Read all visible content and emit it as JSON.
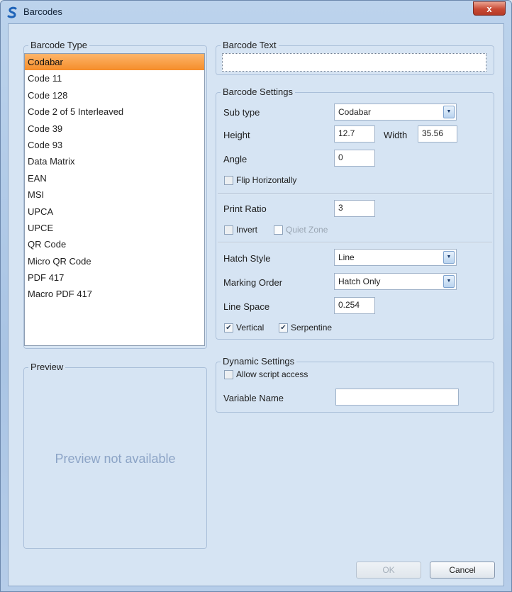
{
  "window": {
    "title": "Barcodes",
    "close_label": "x"
  },
  "barcode_type": {
    "legend": "Barcode Type",
    "items": [
      "Codabar",
      "Code 11",
      "Code 128",
      "Code 2 of 5 Interleaved",
      "Code 39",
      "Code 93",
      "Data Matrix",
      "EAN",
      "MSI",
      "UPCA",
      "UPCE",
      "QR Code",
      "Micro QR Code",
      "PDF 417",
      "Macro PDF 417"
    ],
    "selected": "Codabar"
  },
  "preview": {
    "legend": "Preview",
    "message": "Preview not available"
  },
  "barcode_text": {
    "legend": "Barcode Text",
    "value": ""
  },
  "barcode_settings": {
    "legend": "Barcode Settings",
    "sub_type_label": "Sub type",
    "sub_type_value": "Codabar",
    "height_label": "Height",
    "height_value": "12.7",
    "width_label": "Width",
    "width_value": "35.56",
    "angle_label": "Angle",
    "angle_value": "0",
    "flip_label": "Flip Horizontally",
    "flip_checked": false,
    "print_ratio_label": "Print Ratio",
    "print_ratio_value": "3",
    "invert_label": "Invert",
    "invert_checked": false,
    "quiet_zone_label": "Quiet Zone",
    "quiet_zone_checked": false,
    "hatch_style_label": "Hatch Style",
    "hatch_style_value": "Line",
    "marking_order_label": "Marking Order",
    "marking_order_value": "Hatch Only",
    "line_space_label": "Line Space",
    "line_space_value": "0.254",
    "vertical_label": "Vertical",
    "vertical_checked": true,
    "serpentine_label": "Serpentine",
    "serpentine_checked": true
  },
  "dynamic_settings": {
    "legend": "Dynamic Settings",
    "allow_script_label": "Allow script access",
    "allow_script_checked": false,
    "variable_name_label": "Variable Name",
    "variable_name_value": ""
  },
  "buttons": {
    "ok": "OK",
    "cancel": "Cancel"
  },
  "icons": {
    "app": "app-s-logo-icon",
    "dropdown": "chevron-down-icon",
    "check": "checkmark-icon"
  }
}
